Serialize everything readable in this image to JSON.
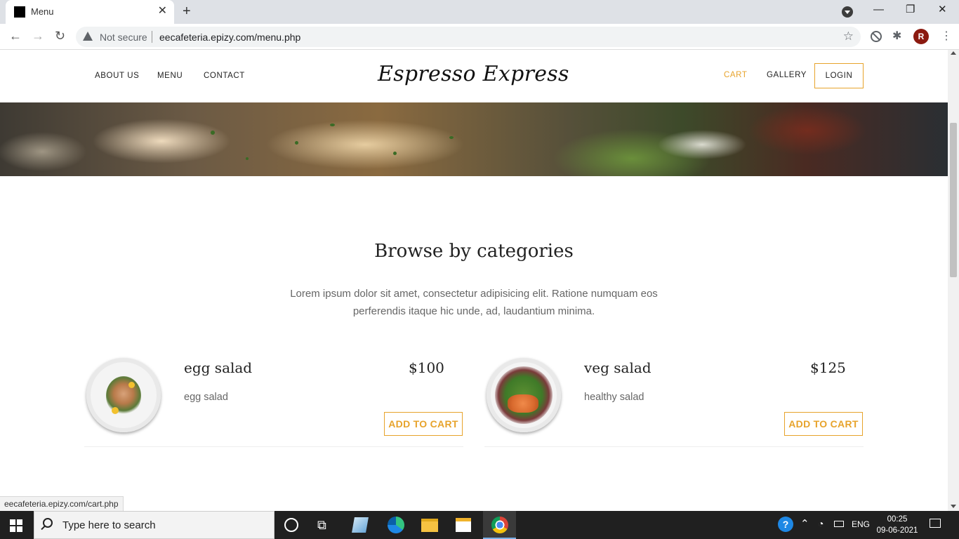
{
  "browser": {
    "tab_title": "Menu",
    "security_label": "Not secure",
    "url": "eecafeteria.epizy.com/menu.php",
    "profile_initial": "R",
    "status_url": "eecafeteria.epizy.com/cart.php"
  },
  "site": {
    "brand": "Espresso Express",
    "nav_left": [
      "ABOUT US",
      "MENU",
      "CONTACT"
    ],
    "nav_right": [
      "CART",
      "GALLERY"
    ],
    "login": "LOGIN"
  },
  "section": {
    "title": "Browse by categories",
    "description": "Lorem ipsum dolor sit amet, consectetur adipisicing elit. Ratione numquam eos perferendis itaque hic unde, ad, laudantium minima."
  },
  "items": [
    {
      "name": "egg salad",
      "price": "$100",
      "description": "egg salad",
      "button": "ADD TO CART"
    },
    {
      "name": "veg salad",
      "price": "$125",
      "description": "healthy salad",
      "button": "ADD TO CART"
    }
  ],
  "taskbar": {
    "search_placeholder": "Type here to search",
    "language": "ENG",
    "time": "00:25",
    "date": "09-06-2021"
  },
  "colors": {
    "accent": "#e7a32b",
    "taskbar": "#202020"
  }
}
